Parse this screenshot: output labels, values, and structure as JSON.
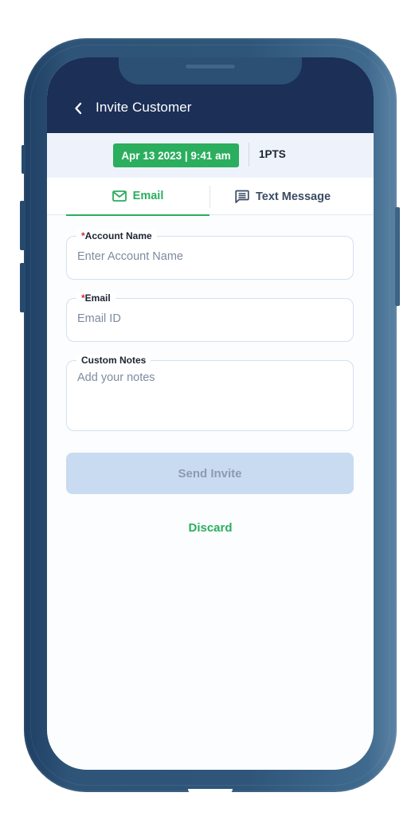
{
  "header": {
    "title": "Invite Customer",
    "back_icon": "chevron-left-icon"
  },
  "info_bar": {
    "date_time": "Apr 13 2023 | 9:41 am",
    "points": "1PTS"
  },
  "tabs": [
    {
      "label": "Email",
      "icon": "mail-icon",
      "active": true
    },
    {
      "label": "Text Message",
      "icon": "message-icon",
      "active": false
    }
  ],
  "form": {
    "account_name": {
      "required_mark": "*",
      "label": "Account Name",
      "placeholder": "Enter Account Name",
      "value": ""
    },
    "email": {
      "required_mark": "*",
      "label": "Email",
      "placeholder": "Email ID",
      "value": ""
    },
    "notes": {
      "label": "Custom Notes",
      "placeholder": "Add your notes",
      "value": ""
    }
  },
  "actions": {
    "send_label": "Send Invite",
    "discard_label": "Discard"
  },
  "colors": {
    "header_bg": "#1b2f57",
    "accent_green": "#2bae5e",
    "disabled_button": "#c9dbf0",
    "required_red": "#e0252b",
    "frame": "#2f5679"
  }
}
